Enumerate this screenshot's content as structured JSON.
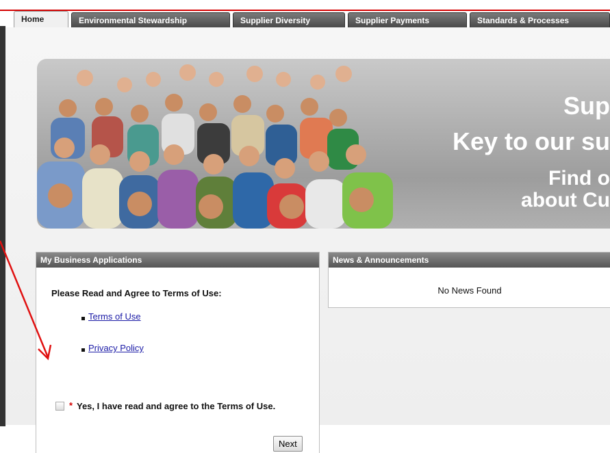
{
  "tabs": [
    {
      "label": "Home",
      "active": true
    },
    {
      "label": "Environmental Stewardship"
    },
    {
      "label": "Supplier Diversity"
    },
    {
      "label": "Supplier Payments"
    },
    {
      "label": "Standards & Processes"
    }
  ],
  "hero": {
    "line1": "Sup",
    "line2": "Key to our su",
    "line3": "Find o",
    "line4": "about Cu"
  },
  "business_panel": {
    "title": "My Business Applications",
    "terms_heading": "Please Read and Agree to Terms of Use:",
    "links": [
      "Terms of Use",
      "Privacy Policy"
    ],
    "required_marker": "*",
    "agree_text": "Yes, I have read and agree to the Terms of Use.",
    "next_label": "Next"
  },
  "news_panel": {
    "title": "News & Announcements",
    "empty_text": "No News Found"
  },
  "colors": {
    "accent_red": "#d40000",
    "link_blue": "#1a1aa6",
    "panel_header": "#555555"
  }
}
